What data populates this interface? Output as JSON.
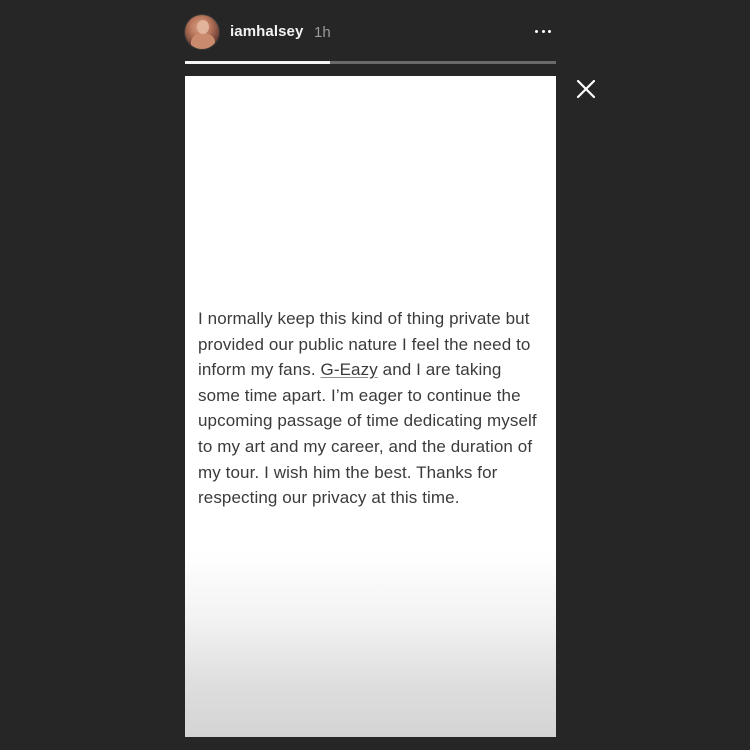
{
  "story": {
    "username": "iamhalsey",
    "time": "1h",
    "progress_fraction": 0.39,
    "text_before_mention": "I normally keep this kind of thing private but provided our public nature I feel the need to inform my fans. ",
    "mention": "G-Eazy",
    "text_after_mention": " and I are taking some time apart. I’m eager to continue the upcoming passage of time dedicating myself to my art and my career, and the duration of my tour. I wish him the best. Thanks for respecting our privacy at this time."
  },
  "icons": {
    "avatar": "profile-avatar",
    "more": "more-options-icon",
    "close": "close-icon"
  },
  "colors": {
    "background": "#262626",
    "story_card": "#ffffff",
    "text": "#3b3b3b",
    "progress_track": "#6a6a6a",
    "progress_fill": "#f5f5f5"
  }
}
